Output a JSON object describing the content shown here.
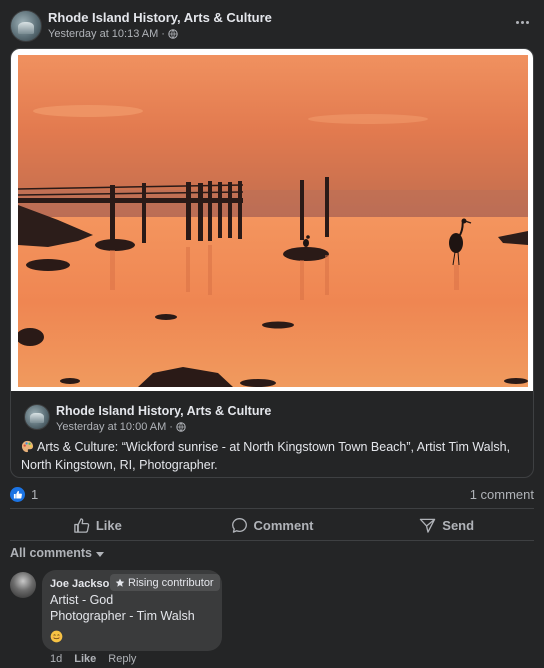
{
  "post": {
    "page_name": "Rhode Island History, Arts & Culture",
    "timestamp": "Yesterday at 10:13 AM",
    "separator": "·",
    "privacy_icon": "globe-icon"
  },
  "shared": {
    "photo_icon": "sunset-photo",
    "page_name": "Rhode Island History, Arts & Culture",
    "timestamp": "Yesterday at 10:00 AM",
    "separator": "·",
    "text_line1": "Arts & Culture:  “Wickford sunrise - at North Kingstown Town Beach”, Artist Tim Walsh,",
    "text_line2": "North Kingstown, RI, Photographer."
  },
  "reactions": {
    "count": "1",
    "comments": "1 comment"
  },
  "actions": {
    "like": "Like",
    "comment": "Comment",
    "send": "Send"
  },
  "filter": {
    "label": "All comments"
  },
  "comment": {
    "author": "Joe Jackson",
    "badge": "Rising contributor",
    "line1": "Artist - God",
    "line2": "Photographer - Tim Walsh",
    "time": "1d",
    "like": "Like",
    "reply": "Reply"
  },
  "colors": {
    "background": "#242526",
    "accent": "#1b74e4",
    "text": "#e4e6eb",
    "muted": "#b0b3b8"
  }
}
